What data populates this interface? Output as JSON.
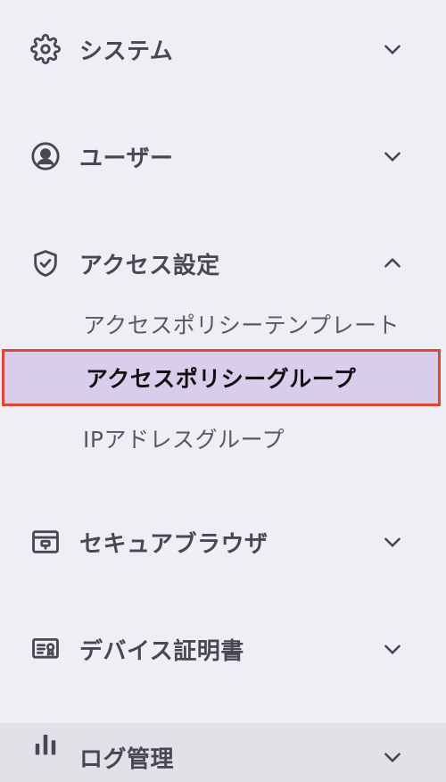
{
  "nav": {
    "sections": [
      {
        "label": "システム",
        "icon": "gear-icon",
        "expanded": false
      },
      {
        "label": "ユーザー",
        "icon": "user-circle-icon",
        "expanded": false
      },
      {
        "label": "アクセス設定",
        "icon": "shield-check-icon",
        "expanded": true,
        "children": [
          {
            "label": "アクセスポリシーテンプレート",
            "selected": false
          },
          {
            "label": "アクセスポリシーグループ",
            "selected": true
          },
          {
            "label": "IPアドレスグループ",
            "selected": false
          }
        ]
      },
      {
        "label": "セキュアブラウザ",
        "icon": "browser-window-icon",
        "expanded": false
      },
      {
        "label": "デバイス証明書",
        "icon": "certificate-icon",
        "expanded": false
      },
      {
        "label": "ログ管理",
        "icon": "bar-chart-icon",
        "expanded": false
      }
    ]
  },
  "colors": {
    "background": "#efeef4",
    "text": "#4a4656",
    "selected_background": "#d8cdea",
    "selected_border": "#e2462f",
    "hover_background": "#e2e1e8"
  }
}
